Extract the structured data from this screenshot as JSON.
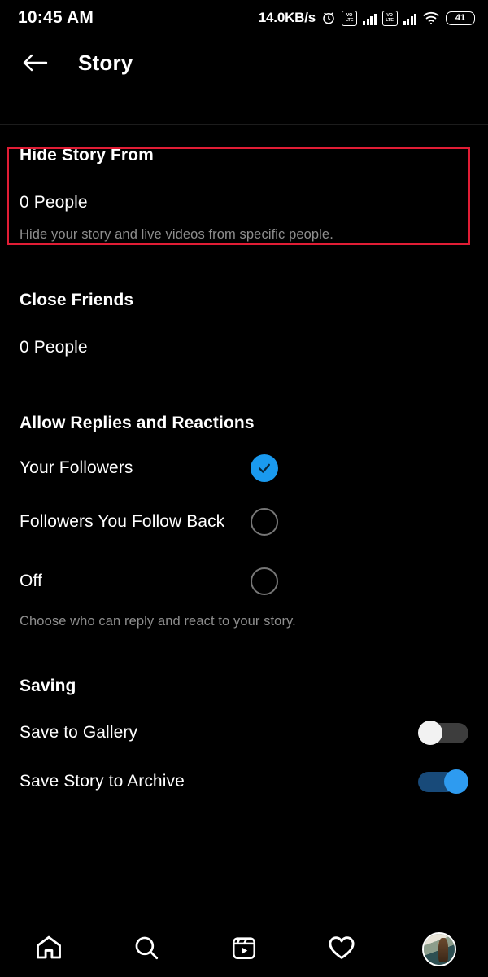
{
  "status_bar": {
    "time": "10:45 AM",
    "network_speed": "14.0KB/s",
    "alarm_icon": "alarm-clock-icon",
    "sim1_label_top": "VO",
    "sim1_label_bottom": "LTE",
    "sim2_label_top": "VO",
    "sim2_label_bottom": "LTE",
    "wifi_icon": "wifi-icon",
    "battery_level": "41"
  },
  "header": {
    "back_icon": "back-arrow-icon",
    "title": "Story"
  },
  "sections": {
    "hide_story": {
      "title": "Hide Story From",
      "value": "0 People",
      "description": "Hide your story and live videos from specific people."
    },
    "close_friends": {
      "title": "Close Friends",
      "value": "0 People"
    },
    "allow_replies": {
      "title": "Allow Replies and Reactions",
      "options": [
        {
          "label": "Your Followers",
          "selected": true
        },
        {
          "label": "Followers You Follow Back",
          "selected": false
        },
        {
          "label": "Off",
          "selected": false
        }
      ],
      "description": "Choose who can reply and react to your story."
    },
    "saving": {
      "title": "Saving",
      "toggles": [
        {
          "label": "Save to Gallery",
          "state": "off"
        },
        {
          "label": "Save Story to Archive",
          "state": "on"
        }
      ]
    }
  },
  "highlight": {
    "color": "#e11d35",
    "target": "Hide Story From"
  },
  "bottom_nav": {
    "items": [
      {
        "icon": "home-icon",
        "label": "Home"
      },
      {
        "icon": "search-icon",
        "label": "Search"
      },
      {
        "icon": "reels-icon",
        "label": "Reels"
      },
      {
        "icon": "heart-icon",
        "label": "Activity"
      },
      {
        "icon": "profile-avatar",
        "label": "Profile"
      }
    ]
  },
  "colors": {
    "background": "#000000",
    "accent_blue": "#1a9aef",
    "muted_text": "#8e8e8e",
    "highlight_red": "#e11d35"
  }
}
